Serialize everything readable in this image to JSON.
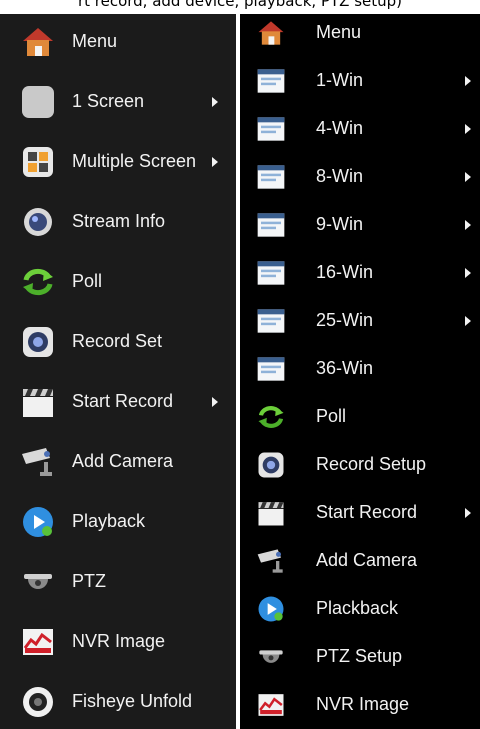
{
  "caption": "rt record, add device, playback, PTZ setup)",
  "left_menu": {
    "items": [
      {
        "label": "Menu",
        "icon": "house-icon"
      },
      {
        "label": "1 Screen",
        "icon": "single-screen-icon",
        "submenu": true
      },
      {
        "label": "Multiple Screen",
        "icon": "multi-screen-icon",
        "submenu": true
      },
      {
        "label": "Stream Info",
        "icon": "lens-icon"
      },
      {
        "label": "Poll",
        "icon": "cycle-arrows-icon"
      },
      {
        "label": "Record Set",
        "icon": "record-camera-icon"
      },
      {
        "label": "Start Record",
        "icon": "clapperboard-icon",
        "submenu": true
      },
      {
        "label": "Add Camera",
        "icon": "cctv-camera-icon"
      },
      {
        "label": "Playback",
        "icon": "playback-icon"
      },
      {
        "label": "PTZ",
        "icon": "dome-camera-icon"
      },
      {
        "label": "NVR Image",
        "icon": "image-chart-icon"
      },
      {
        "label": "Fisheye Unfold",
        "icon": "fisheye-icon"
      }
    ]
  },
  "right_menu": {
    "items": [
      {
        "label": "Menu",
        "icon": "house-icon"
      },
      {
        "label": "1-Win",
        "icon": "window-icon",
        "submenu": true
      },
      {
        "label": "4-Win",
        "icon": "window-icon",
        "submenu": true
      },
      {
        "label": "8-Win",
        "icon": "window-icon",
        "submenu": true
      },
      {
        "label": "9-Win",
        "icon": "window-icon",
        "submenu": true
      },
      {
        "label": "16-Win",
        "icon": "window-icon",
        "submenu": true
      },
      {
        "label": "25-Win",
        "icon": "window-icon",
        "submenu": true
      },
      {
        "label": "36-Win",
        "icon": "window-icon"
      },
      {
        "label": "Poll",
        "icon": "cycle-arrows-icon"
      },
      {
        "label": "Record Setup",
        "icon": "record-camera-icon"
      },
      {
        "label": "Start Record",
        "icon": "clapperboard-icon",
        "submenu": true
      },
      {
        "label": "Add Camera",
        "icon": "cctv-camera-icon"
      },
      {
        "label": "Plackback",
        "icon": "playback-icon"
      },
      {
        "label": "PTZ Setup",
        "icon": "dome-camera-icon"
      },
      {
        "label": "NVR Image",
        "icon": "image-chart-icon"
      }
    ]
  },
  "colors": {
    "left_bg": "#1b1b1b",
    "right_bg": "#000000",
    "text": "#f2f2f2"
  }
}
